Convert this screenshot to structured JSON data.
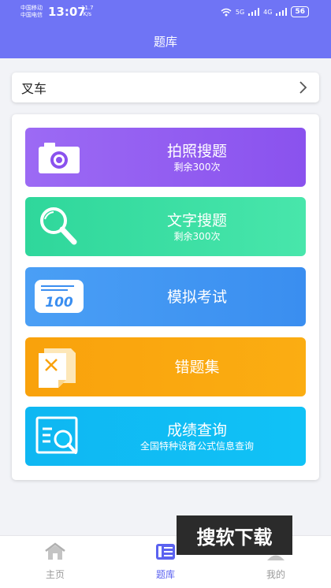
{
  "status_bar": {
    "carrier1": "中国移动",
    "carrier2": "中国电信",
    "time": "13:07",
    "speed_value": "11.7",
    "speed_unit": "K/s",
    "net1": "5G",
    "net2": "4G",
    "battery": "56"
  },
  "header": {
    "title": "题库"
  },
  "category": {
    "label": "叉车"
  },
  "features": [
    {
      "title": "拍照搜题",
      "subtitle": "剩余300次",
      "icon": "camera-icon"
    },
    {
      "title": "文字搜题",
      "subtitle": "剩余300次",
      "icon": "magnifier-icon"
    },
    {
      "title": "模拟考试",
      "subtitle": "",
      "icon": "score-100-icon"
    },
    {
      "title": "错题集",
      "subtitle": "",
      "icon": "wrong-questions-icon"
    },
    {
      "title": "成绩查询",
      "subtitle": "全国特种设备公式信息查询",
      "icon": "score-search-icon"
    }
  ],
  "score_badge": "100",
  "watermark": "搜软下载",
  "nav": [
    {
      "label": "主页",
      "icon": "home-icon",
      "active": false
    },
    {
      "label": "题库",
      "icon": "question-bank-icon",
      "active": true
    },
    {
      "label": "我的",
      "icon": "profile-icon",
      "active": false
    }
  ],
  "colors": {
    "header": "#6f74f5",
    "accent": "#5b62f0",
    "purple": "#9c6af4",
    "green": "#2fd79b",
    "blue": "#4a9ff5",
    "orange": "#f9a20c",
    "cyan": "#0fb7f2"
  }
}
